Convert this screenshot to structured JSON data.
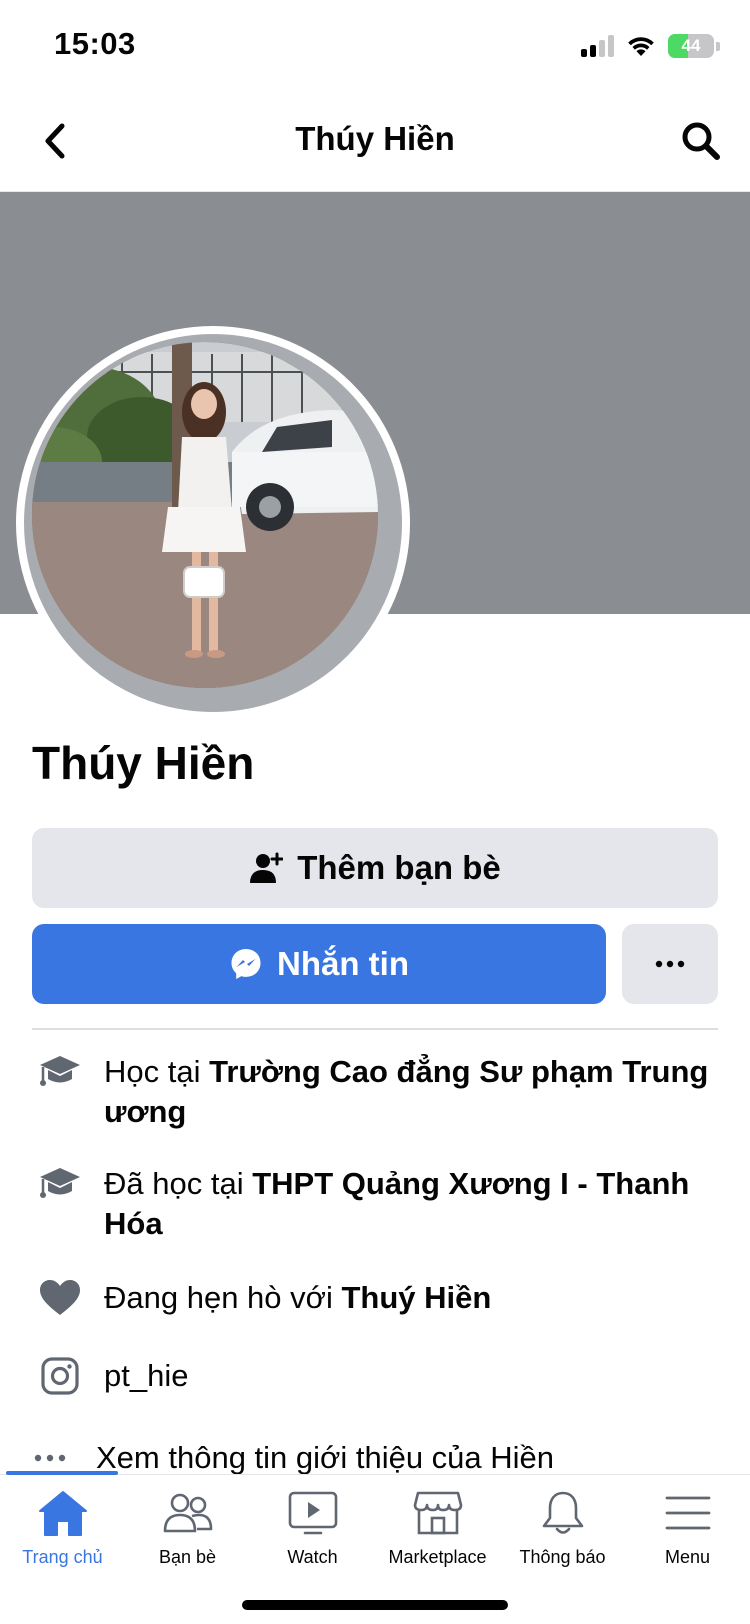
{
  "status_bar": {
    "time": "15:03",
    "battery": "44"
  },
  "header": {
    "title": "Thúy Hiền"
  },
  "profile": {
    "name": "Thúy Hiền"
  },
  "actions": {
    "add_friend": "Thêm bạn bè",
    "message": "Nhắn tin"
  },
  "intro": [
    {
      "icon": "graduation-cap-icon",
      "prefix": "Học tại ",
      "bold": "Trường Cao đẳng Sư phạm Trung ương"
    },
    {
      "icon": "graduation-cap-icon",
      "prefix": "Đã học tại ",
      "bold": "THPT Quảng Xương I - Thanh Hóa"
    },
    {
      "icon": "heart-icon",
      "prefix": "Đang hẹn hò với ",
      "bold": "Thuý Hiền"
    },
    {
      "icon": "instagram-icon",
      "prefix": "pt_hie",
      "bold": ""
    }
  ],
  "about_link": "Xem thông tin giới thiệu của Hiền",
  "tabs": [
    {
      "label": "Trang chủ",
      "icon": "home-icon",
      "active": true
    },
    {
      "label": "Bạn bè",
      "icon": "friends-icon",
      "active": false
    },
    {
      "label": "Watch",
      "icon": "watch-icon",
      "active": false
    },
    {
      "label": "Marketplace",
      "icon": "marketplace-icon",
      "active": false
    },
    {
      "label": "Thông báo",
      "icon": "bell-icon",
      "active": false
    },
    {
      "label": "Menu",
      "icon": "menu-icon",
      "active": false
    }
  ],
  "colors": {
    "accent": "#3a76e1",
    "cover": "#8a8d91",
    "button_gray": "#e4e6eb"
  }
}
